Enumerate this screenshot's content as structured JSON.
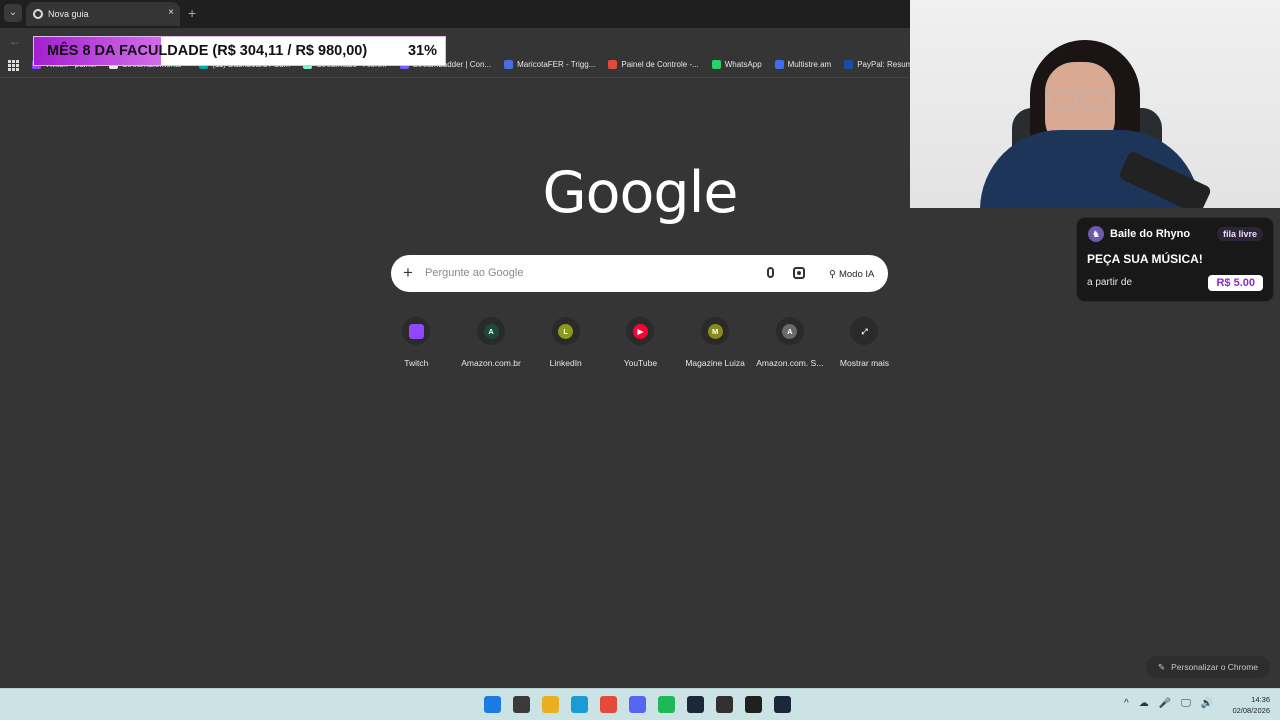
{
  "browser": {
    "tab_title": "Nova guia",
    "new_tab_symbol": "+",
    "close_symbol": "×",
    "back_symbol": "←",
    "tab_search_symbol": "⌄"
  },
  "bookmarks": [
    {
      "label": "Twitch - painel",
      "color": "#9146ff"
    },
    {
      "label": "StreamElements -",
      "color": "#eaeaea"
    },
    {
      "label": "(11) Dashboard / Su...",
      "color": "#00a8a8"
    },
    {
      "label": "Streamlabs - Alert...",
      "color": "#80f5d2"
    },
    {
      "label": "StreamLadder | Con...",
      "color": "#7b5cff"
    },
    {
      "label": "MaricotaFER - Trigg...",
      "color": "#4a6fe3"
    },
    {
      "label": "Painel de Controle -...",
      "color": "#e04a3a"
    },
    {
      "label": "WhatsApp",
      "color": "#25d366"
    },
    {
      "label": "Multistre.am",
      "color": "#3b6ff0"
    },
    {
      "label": "PayPal: Resumo",
      "color": "#1b4aa8"
    }
  ],
  "overlay": {
    "goal_text": "MÊS 8 DA FACULDADE (R$ 304,11 / R$ 980,00)",
    "percent_text": "31%",
    "progress": 0.31
  },
  "music_widget": {
    "channel": "Baile do Rhyno",
    "badge": "fila livre",
    "headline": "PEÇA SUA MÚSICA!",
    "from_label": "a partir de",
    "price": "R$ 5.00"
  },
  "google": {
    "logo": "Google",
    "placeholder": "Pergunte ao Google",
    "plus": "+",
    "ai_mode": "Modo IA",
    "customize": "Personalizar o Chrome"
  },
  "shortcuts": [
    {
      "label": "Twitch",
      "letter": "",
      "icon": "twitch-icon",
      "color": "#9146ff"
    },
    {
      "label": "Amazon.com.br",
      "letter": "A",
      "icon": "letter-icon",
      "color": "#1c4a3a"
    },
    {
      "label": "LinkedIn",
      "letter": "L",
      "icon": "letter-icon",
      "color": "#8a9a1a"
    },
    {
      "label": "YouTube",
      "letter": "▶",
      "icon": "youtube-icon",
      "color": "#ff0033"
    },
    {
      "label": "Magazine Luiza",
      "letter": "M",
      "icon": "letter-icon",
      "color": "#8a8a1a"
    },
    {
      "label": "Amazon.com. S...",
      "letter": "A",
      "icon": "letter-icon",
      "color": "#6a6a6a"
    },
    {
      "label": "Mostrar mais",
      "letter": "⤢",
      "icon": "expand-icon",
      "color": "#2a2a2a"
    }
  ],
  "taskbar": {
    "time": "14:36",
    "date": "02/08/2026",
    "apps": [
      {
        "name": "start-icon",
        "color": "#1c7be0"
      },
      {
        "name": "file-icon",
        "color": "#3a3a3a"
      },
      {
        "name": "folder-icon",
        "color": "#e8b020"
      },
      {
        "name": "edge-icon",
        "color": "#1a9ad6"
      },
      {
        "name": "chrome-icon",
        "color": "#e24a3a"
      },
      {
        "name": "discord-icon",
        "color": "#5865f2"
      },
      {
        "name": "spotify-icon",
        "color": "#1db954"
      },
      {
        "name": "steam-icon",
        "color": "#1b2838"
      },
      {
        "name": "obs-icon",
        "color": "#303030"
      },
      {
        "name": "app-icon",
        "color": "#202020"
      },
      {
        "name": "steam2-icon",
        "color": "#1b2838"
      }
    ],
    "tray": [
      "^",
      "☁",
      "🎤",
      "🖵",
      "🔊"
    ]
  }
}
